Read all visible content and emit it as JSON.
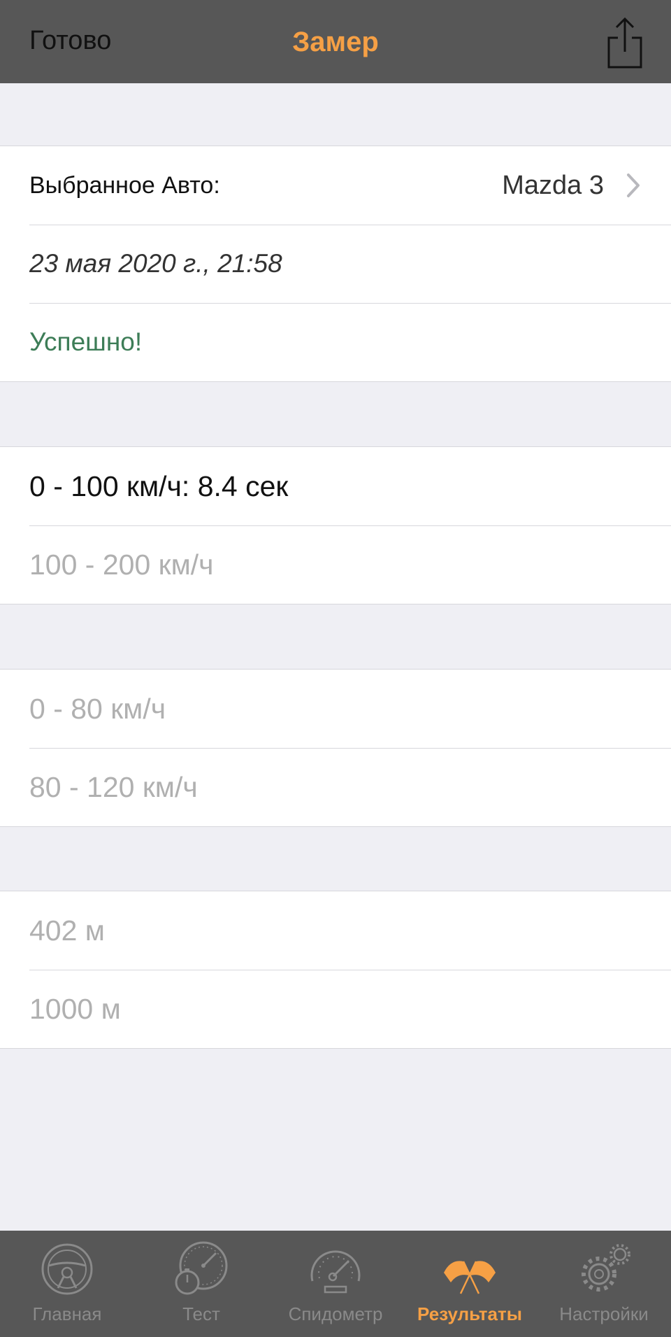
{
  "nav": {
    "done_label": "Готово",
    "title": "Замер",
    "share_icon": "share-icon"
  },
  "info": {
    "car_label": "Выбранное Авто:",
    "car_value": "Mazda 3",
    "date": "23 мая 2020 г., 21:58",
    "status": "Успешно!"
  },
  "results": {
    "r0_100": "0 - 100 км/ч: 8.4 сек",
    "r100_200": "100 - 200 км/ч",
    "r0_80": "0 - 80 км/ч",
    "r80_120": "80 - 120 км/ч",
    "d402": "402 м",
    "d1000": "1000 м"
  },
  "tabs": [
    {
      "label": "Главная",
      "icon": "steering-wheel-icon",
      "active": false
    },
    {
      "label": "Тест",
      "icon": "stopwatch-gauge-icon",
      "active": false
    },
    {
      "label": "Спидометр",
      "icon": "speedometer-icon",
      "active": false
    },
    {
      "label": "Результаты",
      "icon": "racing-flags-icon",
      "active": true
    },
    {
      "label": "Настройки",
      "icon": "gears-icon",
      "active": false
    }
  ],
  "colors": {
    "accent": "#f6a045",
    "success": "#3d7d57",
    "bar_background": "#575757",
    "page_background": "#efeff4"
  }
}
